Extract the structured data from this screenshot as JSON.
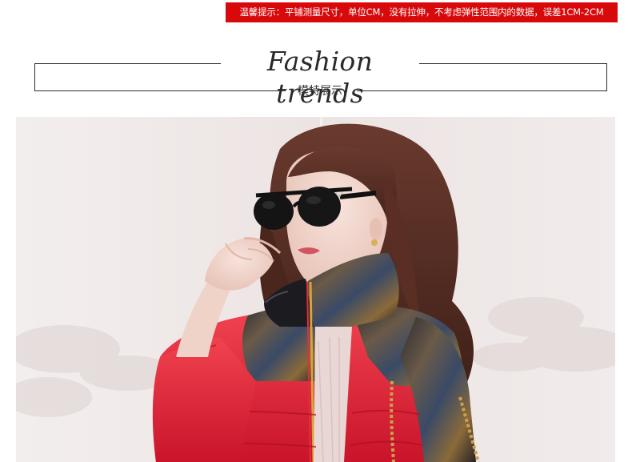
{
  "notice": {
    "text": "温馨提示：平铺测量尺寸，单位CM，没有拉伸，不考虑弹性范围内的数据，误差1CM-2CM",
    "background": "#d8090b"
  },
  "heading": {
    "title": "Fashion trends",
    "subtitle": "模特展示"
  },
  "photo": {
    "subject": "model-wearing-red-printed-puffer-jacket-and-sunglasses"
  }
}
